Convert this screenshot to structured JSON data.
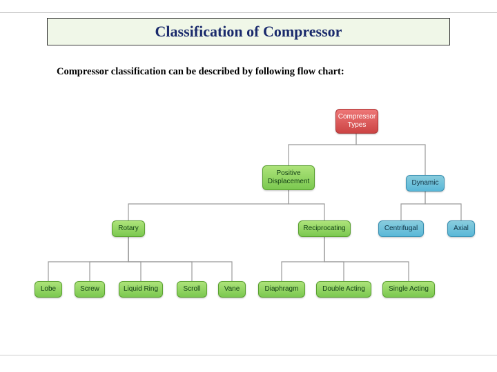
{
  "title": "Classification of Compressor",
  "subtitle": "Compressor classification can be described by following flow chart:",
  "nodes": {
    "root": "Compressor\nTypes",
    "positive": "Positive\nDisplacement",
    "dynamic": "Dynamic",
    "rotary": "Rotary",
    "recip": "Reciprocating",
    "centrif": "Centrifugal",
    "axial": "Axial",
    "lobe": "Lobe",
    "screw": "Screw",
    "liquid": "Liquid Ring",
    "scroll": "Scroll",
    "vane": "Vane",
    "diaphragm": "Diaphragm",
    "double": "Double Acting",
    "single": "Single Acting"
  }
}
